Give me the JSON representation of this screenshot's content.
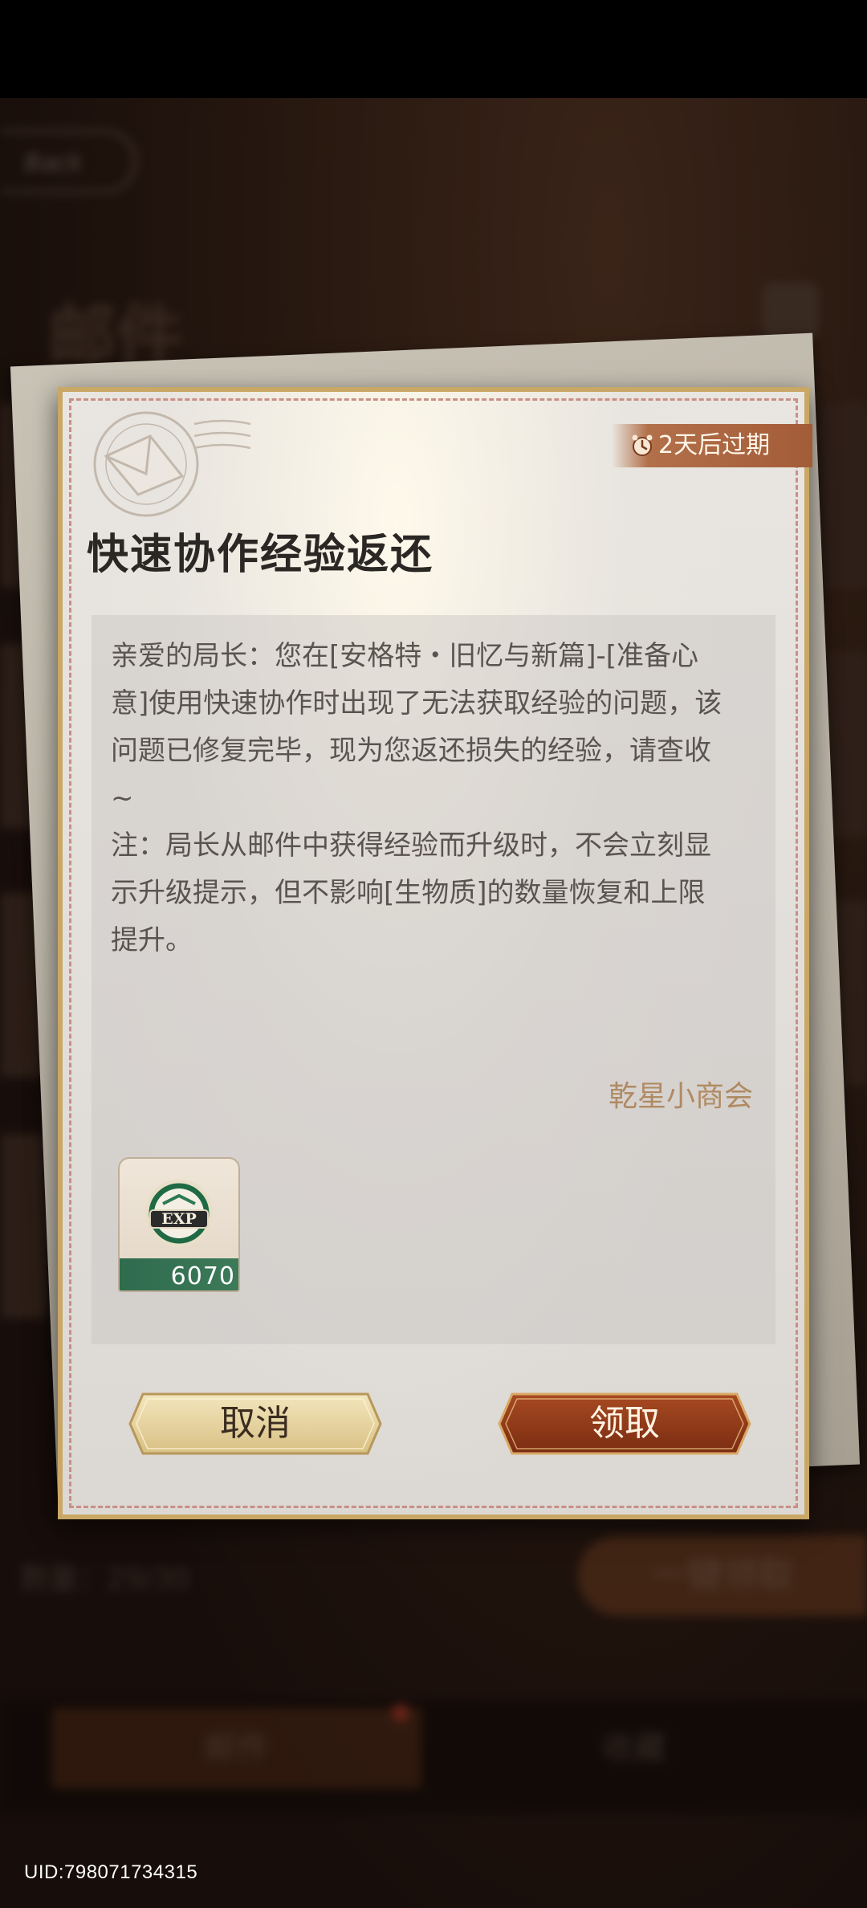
{
  "background": {
    "header_title": "邮件",
    "back_label": "Back",
    "mail_count": "数量：29/30",
    "claim_all_label": "一键领取",
    "tabs": [
      {
        "label": "邮件",
        "selected": true
      },
      {
        "label": "收藏",
        "selected": false
      }
    ]
  },
  "mail": {
    "expiry_label": "2天后过期",
    "title": "快速协作经验返还",
    "body": "亲爱的局长：您在[安格特・旧忆与新篇]-[准备心\n意]使用快速协作时出现了无法获取经验的问题，该\n问题已修复完毕，现为您返还损失的经验，请查收\n~\n注：局长从邮件中获得经验而升级时，不会立刻显\n示升级提示，但不影响[生物质]的数量恢复和上限\n提升。",
    "sender": "乾星小商会",
    "attachments": [
      {
        "icon": "exp-icon",
        "badge_text": "EXP",
        "amount": "6070"
      }
    ],
    "buttons": {
      "cancel_label": "取消",
      "claim_label": "领取"
    }
  },
  "footer": {
    "uid": "UID:798071734315"
  },
  "colors": {
    "accent_claim": "#8e3a1a",
    "accent_cancel": "#e6d29c",
    "expiry_band": "#a35c38",
    "sender_text": "#b08a62",
    "frame_gold": "#c9a765"
  }
}
